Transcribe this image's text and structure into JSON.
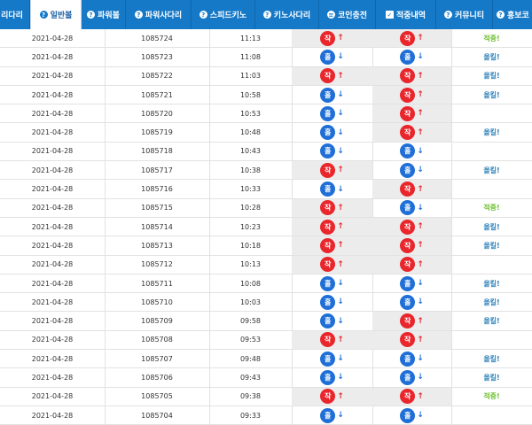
{
  "nav": {
    "tabs": [
      {
        "label": "리다리",
        "icon": "",
        "active": false
      },
      {
        "label": "일반볼",
        "icon": "?",
        "active": true
      },
      {
        "label": "파워볼",
        "icon": "?",
        "active": false
      },
      {
        "label": "파워사다리",
        "icon": "?",
        "active": false
      },
      {
        "label": "스피드키노",
        "icon": "?",
        "active": false
      },
      {
        "label": "키노사다리",
        "icon": "?",
        "active": false
      },
      {
        "label": "코인충전",
        "icon": "coin-icon",
        "active": false
      },
      {
        "label": "적중내역",
        "icon": "check-icon",
        "active": false
      },
      {
        "label": "커뮤니티",
        "icon": "?",
        "active": false
      },
      {
        "label": "홍보코",
        "icon": "?",
        "active": false
      }
    ]
  },
  "colors": {
    "nav_bg": "#1579c8",
    "odd": "#e8262c",
    "even": "#1f6fd6",
    "hit": "#6bbf2e",
    "miss": "#2a7fb8"
  },
  "labels": {
    "odd": "작",
    "even": "홀"
  },
  "rows": [
    {
      "date": "2021-04-28",
      "round": "1085724",
      "time": "11:13",
      "pick": "odd",
      "result": "odd",
      "status": "적중!",
      "status_type": "hit"
    },
    {
      "date": "2021-04-28",
      "round": "1085723",
      "time": "11:08",
      "pick": "even",
      "result": "even",
      "status": "올킬!",
      "status_type": "miss"
    },
    {
      "date": "2021-04-28",
      "round": "1085722",
      "time": "11:03",
      "pick": "odd",
      "result": "odd",
      "status": "올킬!",
      "status_type": "miss"
    },
    {
      "date": "2021-04-28",
      "round": "1085721",
      "time": "10:58",
      "pick": "even",
      "result": "odd",
      "status": "올킬!",
      "status_type": "miss"
    },
    {
      "date": "2021-04-28",
      "round": "1085720",
      "time": "10:53",
      "pick": "even",
      "result": "odd",
      "status": "",
      "status_type": "miss"
    },
    {
      "date": "2021-04-28",
      "round": "1085719",
      "time": "10:48",
      "pick": "even",
      "result": "odd",
      "status": "올킬!",
      "status_type": "miss"
    },
    {
      "date": "2021-04-28",
      "round": "1085718",
      "time": "10:43",
      "pick": "even",
      "result": "even",
      "status": "",
      "status_type": "miss"
    },
    {
      "date": "2021-04-28",
      "round": "1085717",
      "time": "10:38",
      "pick": "odd",
      "result": "even",
      "status": "올킬!",
      "status_type": "miss"
    },
    {
      "date": "2021-04-28",
      "round": "1085716",
      "time": "10:33",
      "pick": "even",
      "result": "odd",
      "status": "",
      "status_type": "miss"
    },
    {
      "date": "2021-04-28",
      "round": "1085715",
      "time": "10:28",
      "pick": "odd",
      "result": "even",
      "status": "적중!",
      "status_type": "hit"
    },
    {
      "date": "2021-04-28",
      "round": "1085714",
      "time": "10:23",
      "pick": "odd",
      "result": "odd",
      "status": "올킬!",
      "status_type": "miss"
    },
    {
      "date": "2021-04-28",
      "round": "1085713",
      "time": "10:18",
      "pick": "odd",
      "result": "odd",
      "status": "올킬!",
      "status_type": "miss"
    },
    {
      "date": "2021-04-28",
      "round": "1085712",
      "time": "10:13",
      "pick": "odd",
      "result": "odd",
      "status": "",
      "status_type": "miss"
    },
    {
      "date": "2021-04-28",
      "round": "1085711",
      "time": "10:08",
      "pick": "even",
      "result": "even",
      "status": "올킬!",
      "status_type": "miss"
    },
    {
      "date": "2021-04-28",
      "round": "1085710",
      "time": "10:03",
      "pick": "even",
      "result": "even",
      "status": "올킬!",
      "status_type": "miss"
    },
    {
      "date": "2021-04-28",
      "round": "1085709",
      "time": "09:58",
      "pick": "even",
      "result": "odd",
      "status": "올킬!",
      "status_type": "miss"
    },
    {
      "date": "2021-04-28",
      "round": "1085708",
      "time": "09:53",
      "pick": "odd",
      "result": "odd",
      "status": "",
      "status_type": "miss"
    },
    {
      "date": "2021-04-28",
      "round": "1085707",
      "time": "09:48",
      "pick": "even",
      "result": "even",
      "status": "올킬!",
      "status_type": "miss"
    },
    {
      "date": "2021-04-28",
      "round": "1085706",
      "time": "09:43",
      "pick": "even",
      "result": "even",
      "status": "올킬!",
      "status_type": "miss"
    },
    {
      "date": "2021-04-28",
      "round": "1085705",
      "time": "09:38",
      "pick": "odd",
      "result": "odd",
      "status": "적중!",
      "status_type": "hit"
    },
    {
      "date": "2021-04-28",
      "round": "1085704",
      "time": "09:33",
      "pick": "even",
      "result": "even",
      "status": "",
      "status_type": "miss"
    }
  ]
}
